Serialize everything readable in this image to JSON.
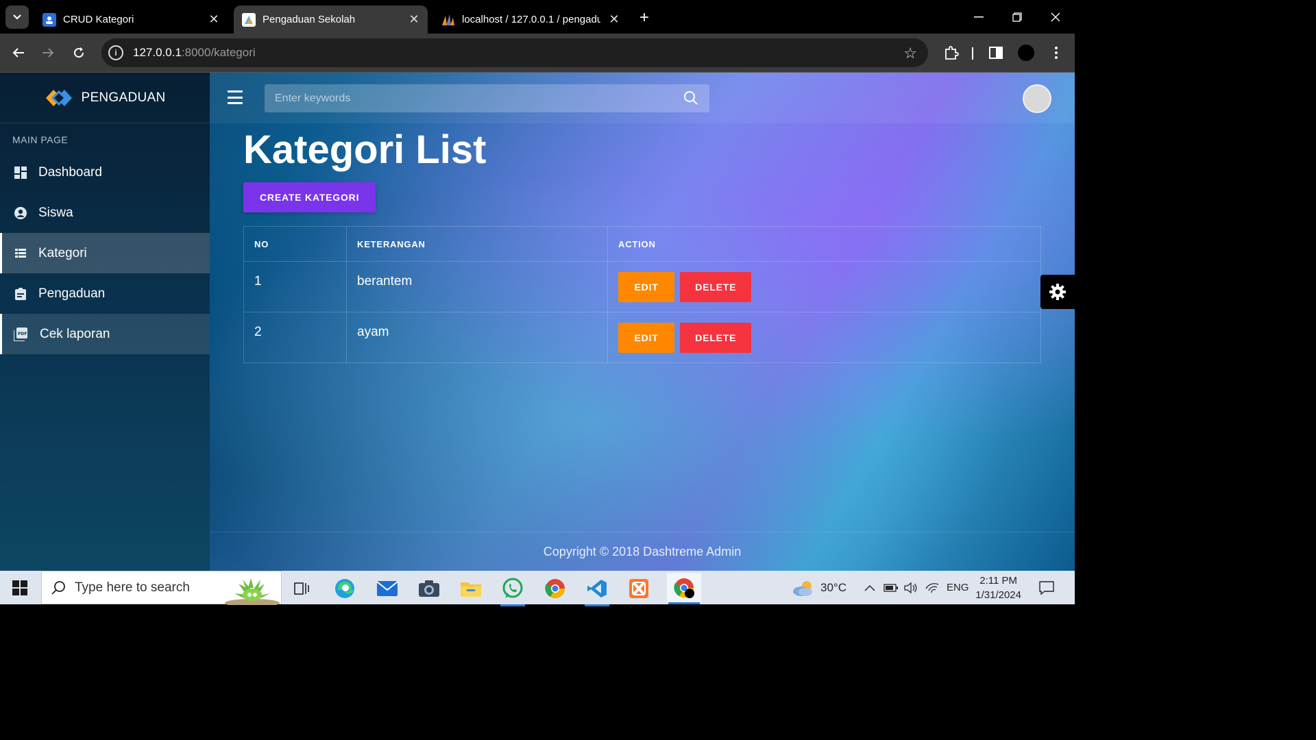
{
  "browser": {
    "tabs": [
      {
        "title": "CRUD Kategori",
        "active": false
      },
      {
        "title": "Pengaduan Sekolah",
        "active": true
      },
      {
        "title": "localhost / 127.0.0.1 / pengadua",
        "active": false
      }
    ],
    "url_host": "127.0.0.1",
    "url_rest": ":8000/kategori"
  },
  "sidebar": {
    "brand": "PENGADUAN",
    "section_header": "MAIN PAGE",
    "items": [
      {
        "label": "Dashboard",
        "icon": "dashboard-icon"
      },
      {
        "label": "Siswa",
        "icon": "user-circle-icon"
      },
      {
        "label": "Kategori",
        "icon": "list-icon"
      },
      {
        "label": "Pengaduan",
        "icon": "clipboard-icon"
      },
      {
        "label": "Cek laporan",
        "icon": "pdf-icon"
      }
    ],
    "active_item": "Kategori"
  },
  "topbar": {
    "search_placeholder": "Enter keywords"
  },
  "main": {
    "title": "Kategori List",
    "create_label": "CREATE KATEGORI",
    "table": {
      "headers": [
        "NO",
        "KETERANGAN",
        "ACTION"
      ],
      "rows": [
        {
          "no": "1",
          "keterangan": "berantem"
        },
        {
          "no": "2",
          "keterangan": "ayam"
        }
      ],
      "edit_label": "EDIT",
      "delete_label": "DELETE"
    }
  },
  "footer": {
    "text": "Copyright © 2018 Dashtreme Admin"
  },
  "taskbar": {
    "search_text": "Type here to search",
    "weather": "30°C",
    "language": "ENG",
    "time": "2:11 PM",
    "date": "1/31/2024"
  },
  "colors": {
    "create_button": "#7a34ea",
    "edit_button": "#ff8800",
    "delete_button": "#f5333f"
  }
}
